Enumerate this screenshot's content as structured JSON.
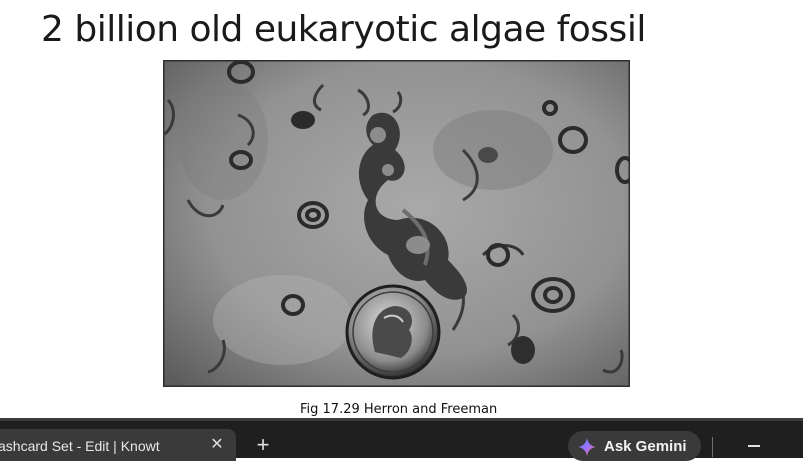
{
  "slide": {
    "title": "2 billion old eukaryotic algae fossil",
    "caption": "Fig 17.29 Herron and Freeman"
  },
  "browser": {
    "active_tab_title": "ashcard Set - Edit | Knowt",
    "tab_close_glyph": "✕",
    "new_tab_glyph": "+",
    "ask_gemini_label": "Ask Gemini",
    "icons": {
      "close": "close-icon",
      "new_tab": "plus-icon",
      "gemini": "gemini-sparkle-icon",
      "minimize": "minimize-icon"
    }
  }
}
